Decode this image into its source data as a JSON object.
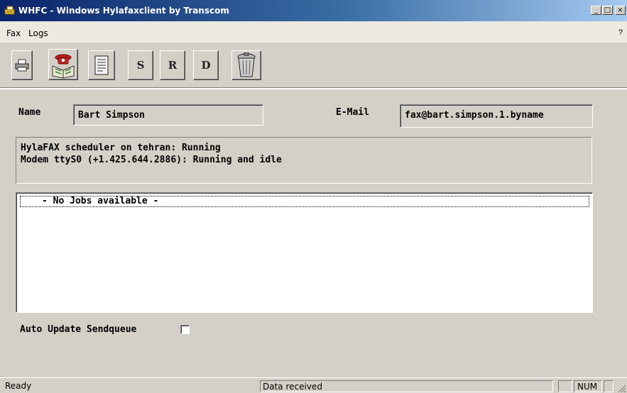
{
  "window": {
    "title": "WHFC - Windows Hylafaxclient by Transcom",
    "controls": {
      "minimize": "_",
      "maximize": "□",
      "close": "×"
    }
  },
  "menu": {
    "items": [
      "Fax",
      "Logs"
    ],
    "help": "?"
  },
  "toolbar": {
    "buttons": [
      {
        "icon": "printer-icon"
      },
      {
        "icon": "phonebook-icon"
      },
      {
        "icon": "document-icon"
      },
      {
        "label": "S"
      },
      {
        "label": "R"
      },
      {
        "label": "D"
      },
      {
        "icon": "trash-icon"
      }
    ]
  },
  "form": {
    "name_label": "Name",
    "name_value": "Bart Simpson",
    "email_label": "E-Mail",
    "email_value": "fax@bart.simpson.1.byname"
  },
  "server_status": [
    "HylaFAX scheduler on tehran: Running",
    "Modem ttyS0 (+1.425.644.2886): Running and idle"
  ],
  "jobs": {
    "empty_text": "- No Jobs available -"
  },
  "auto_update": {
    "label": "Auto Update Sendqueue",
    "checked": false
  },
  "statusbar": {
    "left": "Ready",
    "middle": "Data received",
    "num": "NUM"
  }
}
